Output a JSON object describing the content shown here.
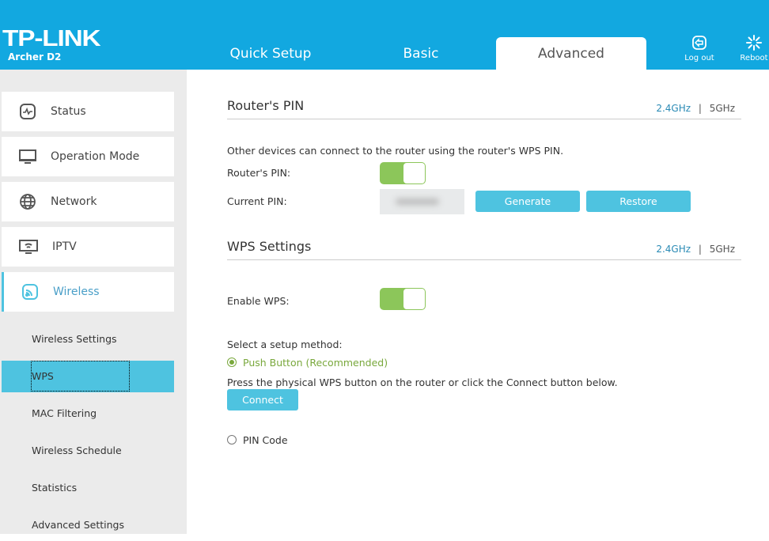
{
  "brand": {
    "logo": "TP-LINK",
    "model": "Archer D2"
  },
  "tabs": [
    {
      "label": "Quick Setup"
    },
    {
      "label": "Basic"
    },
    {
      "label": "Advanced",
      "active": true
    }
  ],
  "header_buttons": {
    "logout": "Log out",
    "reboot": "Reboot"
  },
  "sidebar": {
    "items": [
      {
        "label": "Status",
        "icon": "status-icon"
      },
      {
        "label": "Operation Mode",
        "icon": "monitor-icon"
      },
      {
        "label": "Network",
        "icon": "globe-icon"
      },
      {
        "label": "IPTV",
        "icon": "iptv-icon"
      },
      {
        "label": "Wireless",
        "icon": "wireless-icon",
        "active": true
      }
    ],
    "subitems": [
      {
        "label": "Wireless Settings"
      },
      {
        "label": "WPS",
        "active": true
      },
      {
        "label": "MAC Filtering"
      },
      {
        "label": "Wireless Schedule"
      },
      {
        "label": "Statistics"
      },
      {
        "label": "Advanced Settings"
      }
    ]
  },
  "routers_pin": {
    "title": "Router's PIN",
    "band_24": "2.4GHz",
    "separator": "|",
    "band_5": "5GHz",
    "description": "Other devices can connect to the router using the router's WPS PIN.",
    "pin_label": "Router's PIN:",
    "pin_enabled": true,
    "current_pin_label": "Current PIN:",
    "generate": "Generate",
    "restore": "Restore"
  },
  "wps": {
    "title": "WPS Settings",
    "band_24": "2.4GHz",
    "separator": "|",
    "band_5": "5GHz",
    "enable_label": "Enable WPS:",
    "enabled": true,
    "method_label": "Select a setup method:",
    "push_button": "Push Button (Recommended)",
    "push_selected": true,
    "push_desc": "Press the physical WPS button on the router or click the Connect button below.",
    "connect": "Connect",
    "pin_code": "PIN Code"
  },
  "colors": {
    "header": "#12a8e0",
    "accent": "#4ec3e0",
    "toggle_on": "#8cc65a",
    "selected_radio": "#79a83c"
  }
}
